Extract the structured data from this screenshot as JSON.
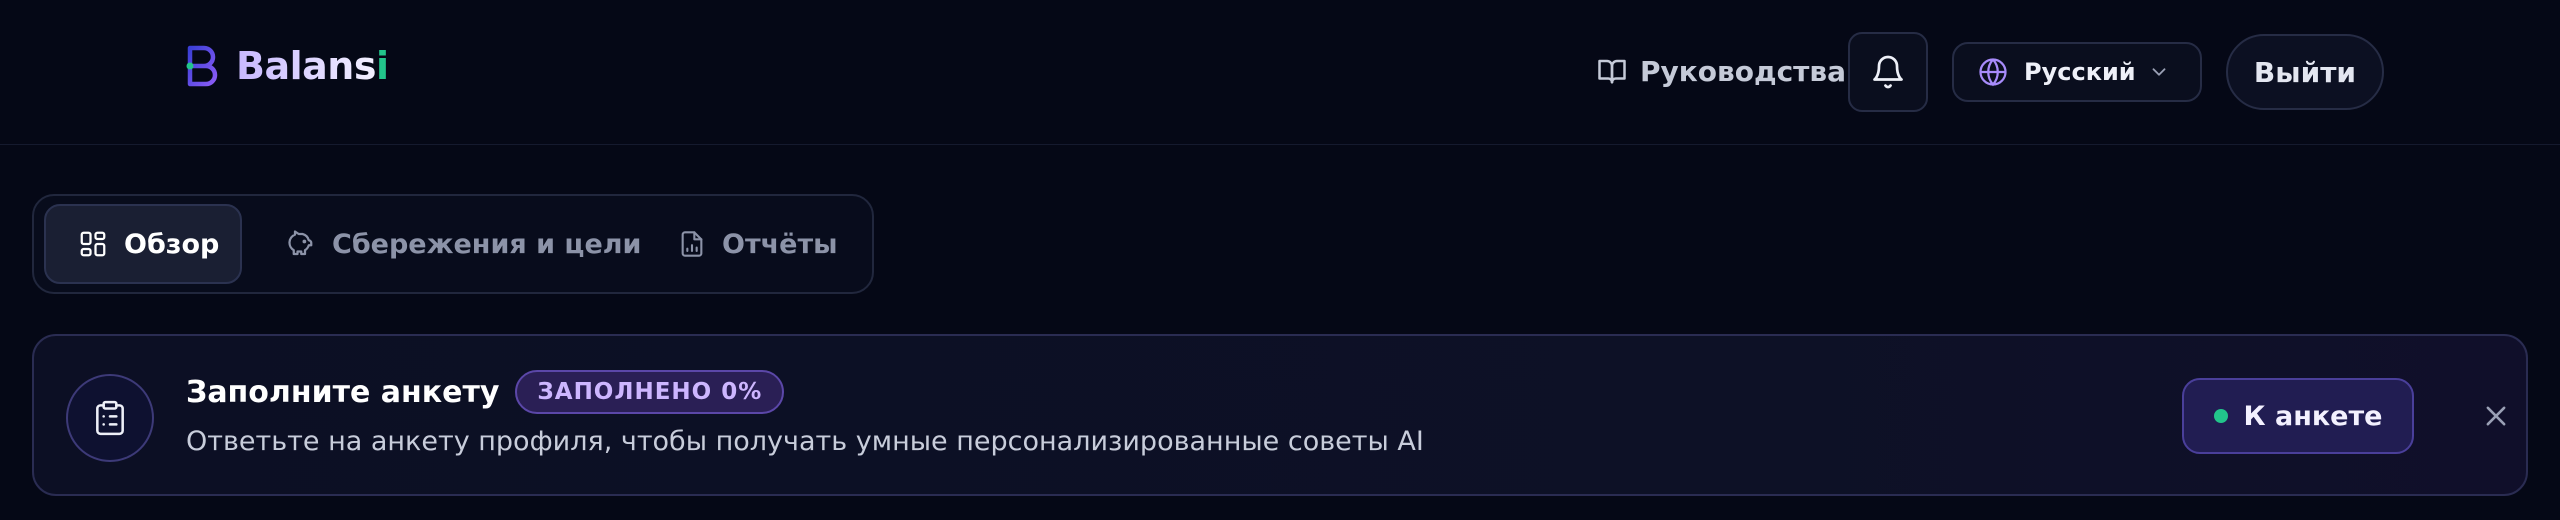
{
  "header": {
    "logo_text_main": "Balans",
    "logo_text_accent": "i",
    "logo_icon": "balansi-logo-mark",
    "guides_label": "Руководства",
    "guides_icon": "book-open-icon",
    "bell_icon": "bell-icon",
    "language_label": "Русский",
    "language_icon": "globe-icon",
    "logout_label": "Выйти"
  },
  "tabs": [
    {
      "label": "Обзор",
      "icon": "dashboard-grid-icon",
      "active": true
    },
    {
      "label": "Сбережения и цели",
      "icon": "piggy-bank-icon",
      "active": false
    },
    {
      "label": "Отчёты",
      "icon": "report-chart-icon",
      "active": false
    }
  ],
  "banner": {
    "icon": "clipboard-list-icon",
    "title": "Заполните анкету",
    "badge": "ЗАПОЛНЕНО 0%",
    "progress_percent": 0,
    "description": "Ответьте на анкету профиля, чтобы получать умные персонализированные советы AI",
    "cta_label": "К анкете",
    "close_icon": "close-icon"
  },
  "colors": {
    "background": "#050816",
    "accent_purple": "#8b7cf6",
    "accent_green": "#22c58b",
    "badge_text": "#cdb6ff"
  }
}
